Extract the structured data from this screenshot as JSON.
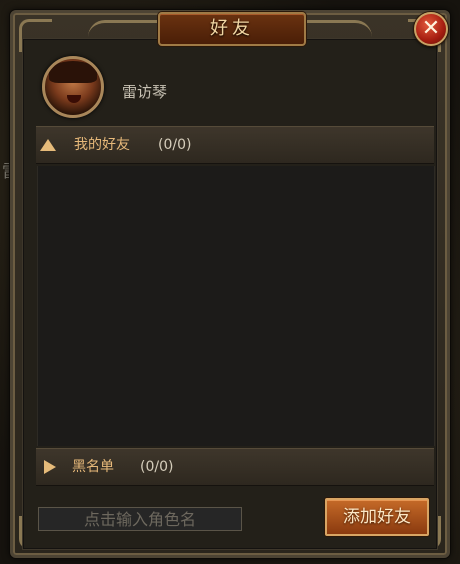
{
  "window": {
    "title": "好友",
    "close_glyph": "✕"
  },
  "background": {
    "stray_text": "雷"
  },
  "profile": {
    "avatar_icon": "character-portrait",
    "name": "雷访琴"
  },
  "friends_section": {
    "expand_icon": "triangle-up-icon",
    "title": "我的好友",
    "count": "(0/0)",
    "items": []
  },
  "blacklist_section": {
    "expand_icon": "triangle-right-icon",
    "title": "黑名单",
    "count": "(0/0)",
    "items": []
  },
  "footer": {
    "input_placeholder": "点击输入角色名",
    "input_value": "",
    "add_button_label": "添加好友"
  },
  "colors": {
    "accent_gold": "#e7b97a",
    "button_orange": "#c56a28",
    "close_red": "#a51d10"
  }
}
